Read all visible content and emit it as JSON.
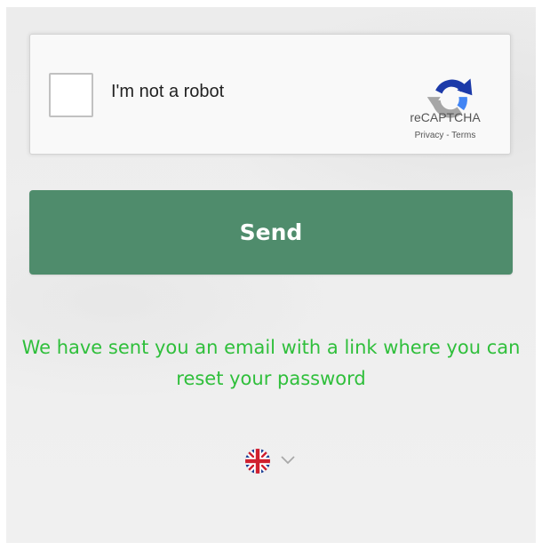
{
  "captcha": {
    "checkbox_label": "I'm not a robot",
    "brand": "reCAPTCHA",
    "privacy_link": "Privacy",
    "separator": " - ",
    "terms_link": "Terms",
    "checked": false
  },
  "form": {
    "send_label": "Send"
  },
  "status": {
    "message": "We have sent you an email with a link where you can reset your password",
    "color": "#2fbf3b"
  },
  "language": {
    "icon": "uk-flag-icon",
    "dropdown_icon": "chevron-down-icon"
  },
  "colors": {
    "send_button": "#4f8c6c",
    "background": "#eeeeee"
  }
}
